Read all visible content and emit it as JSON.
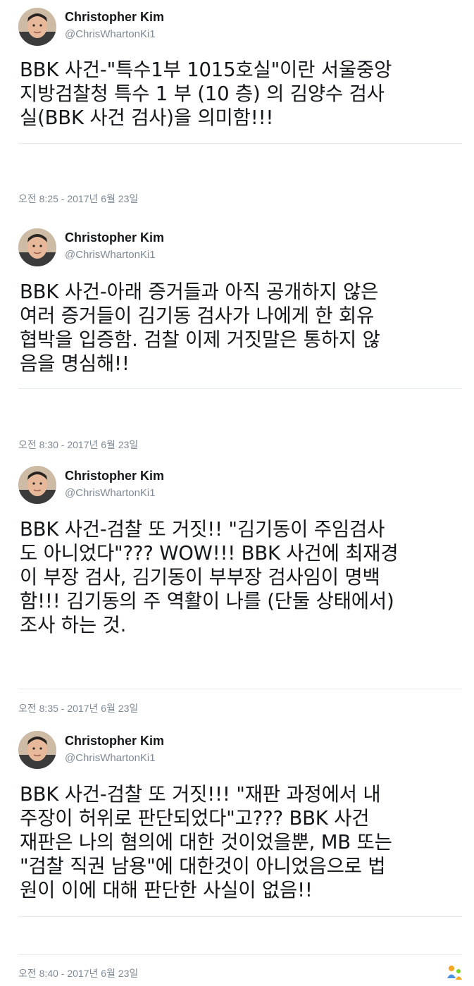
{
  "tweets": [
    {
      "name": "Christopher Kim",
      "handle": "@ChrisWhartonKi1",
      "text": "BBK 사건-\"특수1부 1015호실\"이란 서울중앙\n지방검찰청 특수 1 부 (10 층) 의 김양수 검사\n실(BBK 사건 검사)을 의미함!!!",
      "time": "오전 8:25 - 2017년 6월 23일"
    },
    {
      "name": "Christopher Kim",
      "handle": "@ChrisWhartonKi1",
      "text": "BBK 사건-아래 증거들과 아직 공개하지 않은\n여러 증거들이 김기동 검사가 나에게 한 회유\n협박을 입증함.  검찰 이제 거짓말은 통하지 않\n음을 명심해!!",
      "time": "오전 8:30 - 2017년 6월 23일"
    },
    {
      "name": "Christopher Kim",
      "handle": "@ChrisWhartonKi1",
      "text": "BBK 사건-검찰 또 거짓!! \"김기동이 주임검사\n도 아니었다\"??? WOW!!! BBK 사건에 최재경\n이 부장 검사, 김기동이 부부장 검사임이 명백\n함!!! 김기동의 주 역활이 나를 (단둘 상태에서)\n조사 하는 것.",
      "time": "오전 8:35 - 2017년 6월 23일"
    },
    {
      "name": "Christopher Kim",
      "handle": "@ChrisWhartonKi1",
      "text": "BBK 사건-검찰 또 거짓!!! \"재판 과정에서 내\n주장이 허위로 판단되었다\"고???  BBK 사건\n재판은 나의 혐의에 대한 것이었을뿐, MB 또는\n\"검찰 직권 남용\"에 대한것이 아니었음으로 법\n원이 이에 대해 판단한 사실이 없음!!",
      "time": "오전 8:40 - 2017년 6월 23일"
    }
  ],
  "icons": {
    "corner": "watermark-person-icon",
    "accent_color": "#f5a623"
  }
}
